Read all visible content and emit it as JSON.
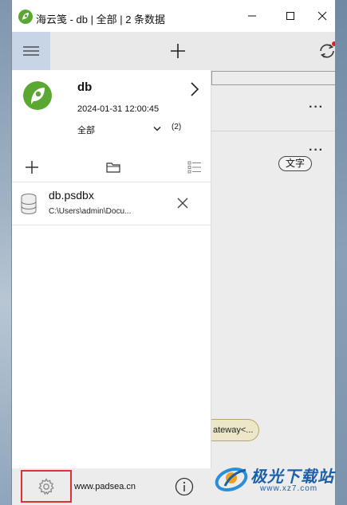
{
  "window": {
    "title": "海云笺 - db | 全部 | 2 条数据"
  },
  "icons": {
    "app": "leaf-logo-icon",
    "menu": "hamburger-menu-icon",
    "add": "plus-icon",
    "sync": "sync-icon",
    "more": "more-dots-icon"
  },
  "database": {
    "name": "db",
    "date": "2024-01-31 12:00:45",
    "filter": "全部",
    "count": "(2)"
  },
  "file": {
    "name": "db.psdbx",
    "path": "C:\\Users\\admin\\Docu..."
  },
  "main": {
    "more": "···",
    "tag": "文字",
    "gateway": "ateway<..."
  },
  "footer": {
    "url": "www.padsea.cn"
  },
  "watermark": {
    "brand": "极光下载站",
    "url": "www.xz7.com"
  },
  "colors": {
    "brand_green": "#5aa832",
    "menu_highlight": "#c7d5e6",
    "sync_dot": "#e02020",
    "highlight_box": "#e03030"
  }
}
